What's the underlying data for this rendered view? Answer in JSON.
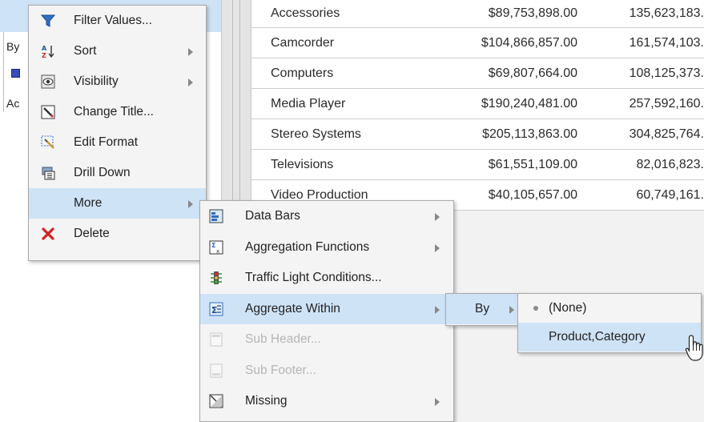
{
  "left_panel": {
    "fragments": [
      "By",
      "Ac"
    ]
  },
  "report": {
    "rows": [
      {
        "category": "Accessories",
        "revenue": "$89,753,898.00",
        "count": "135,623,183."
      },
      {
        "category": "Camcorder",
        "revenue": "$104,866,857.00",
        "count": "161,574,103."
      },
      {
        "category": "Computers",
        "revenue": "$69,807,664.00",
        "count": "108,125,373."
      },
      {
        "category": "Media Player",
        "revenue": "$190,240,481.00",
        "count": "257,592,160."
      },
      {
        "category": "Stereo Systems",
        "revenue": "$205,113,863.00",
        "count": "304,825,764."
      },
      {
        "category": "Televisions",
        "revenue": "$61,551,109.00",
        "count": "82,016,823."
      },
      {
        "category": "Video Production",
        "revenue": "$40,105,657.00",
        "count": "60,749,161."
      }
    ]
  },
  "context_menu": {
    "items": [
      {
        "label": "Filter Values...",
        "icon": "filter-icon",
        "submenu": false
      },
      {
        "label": "Sort",
        "icon": "sort-az-icon",
        "submenu": true
      },
      {
        "label": "Visibility",
        "icon": "eye-icon",
        "submenu": true
      },
      {
        "label": "Change Title...",
        "icon": "pencil-icon",
        "submenu": false
      },
      {
        "label": "Edit Format",
        "icon": "format-icon",
        "submenu": false
      },
      {
        "label": "Drill Down",
        "icon": "drill-down-icon",
        "submenu": false
      },
      {
        "label": "More",
        "icon": "",
        "submenu": true,
        "highlighted": true
      },
      {
        "label": "Delete",
        "icon": "delete-x-icon",
        "submenu": false
      }
    ]
  },
  "more_menu": {
    "items": [
      {
        "label": "Data Bars",
        "icon": "data-bars-icon",
        "submenu": true
      },
      {
        "label": "Aggregation Functions",
        "icon": "aggregation-icon",
        "submenu": true
      },
      {
        "label": "Traffic Light Conditions...",
        "icon": "traffic-light-icon",
        "submenu": false
      },
      {
        "label": "Aggregate Within",
        "icon": "aggregate-within-icon",
        "submenu": true,
        "highlighted": true
      },
      {
        "label": "Sub Header...",
        "icon": "sub-header-icon",
        "submenu": false,
        "disabled": true
      },
      {
        "label": "Sub Footer...",
        "icon": "sub-footer-icon",
        "submenu": false,
        "disabled": true
      },
      {
        "label": "Missing",
        "icon": "missing-icon",
        "submenu": true
      }
    ]
  },
  "by_menu": {
    "label": "By"
  },
  "by_options": {
    "items": [
      {
        "label": "(None)",
        "selected": true
      },
      {
        "label": "Product,Category",
        "highlighted": true
      }
    ]
  },
  "colors": {
    "highlight": "#cfe3f7",
    "menu_bg": "#f4f4f4",
    "delete_red": "#d42020"
  }
}
